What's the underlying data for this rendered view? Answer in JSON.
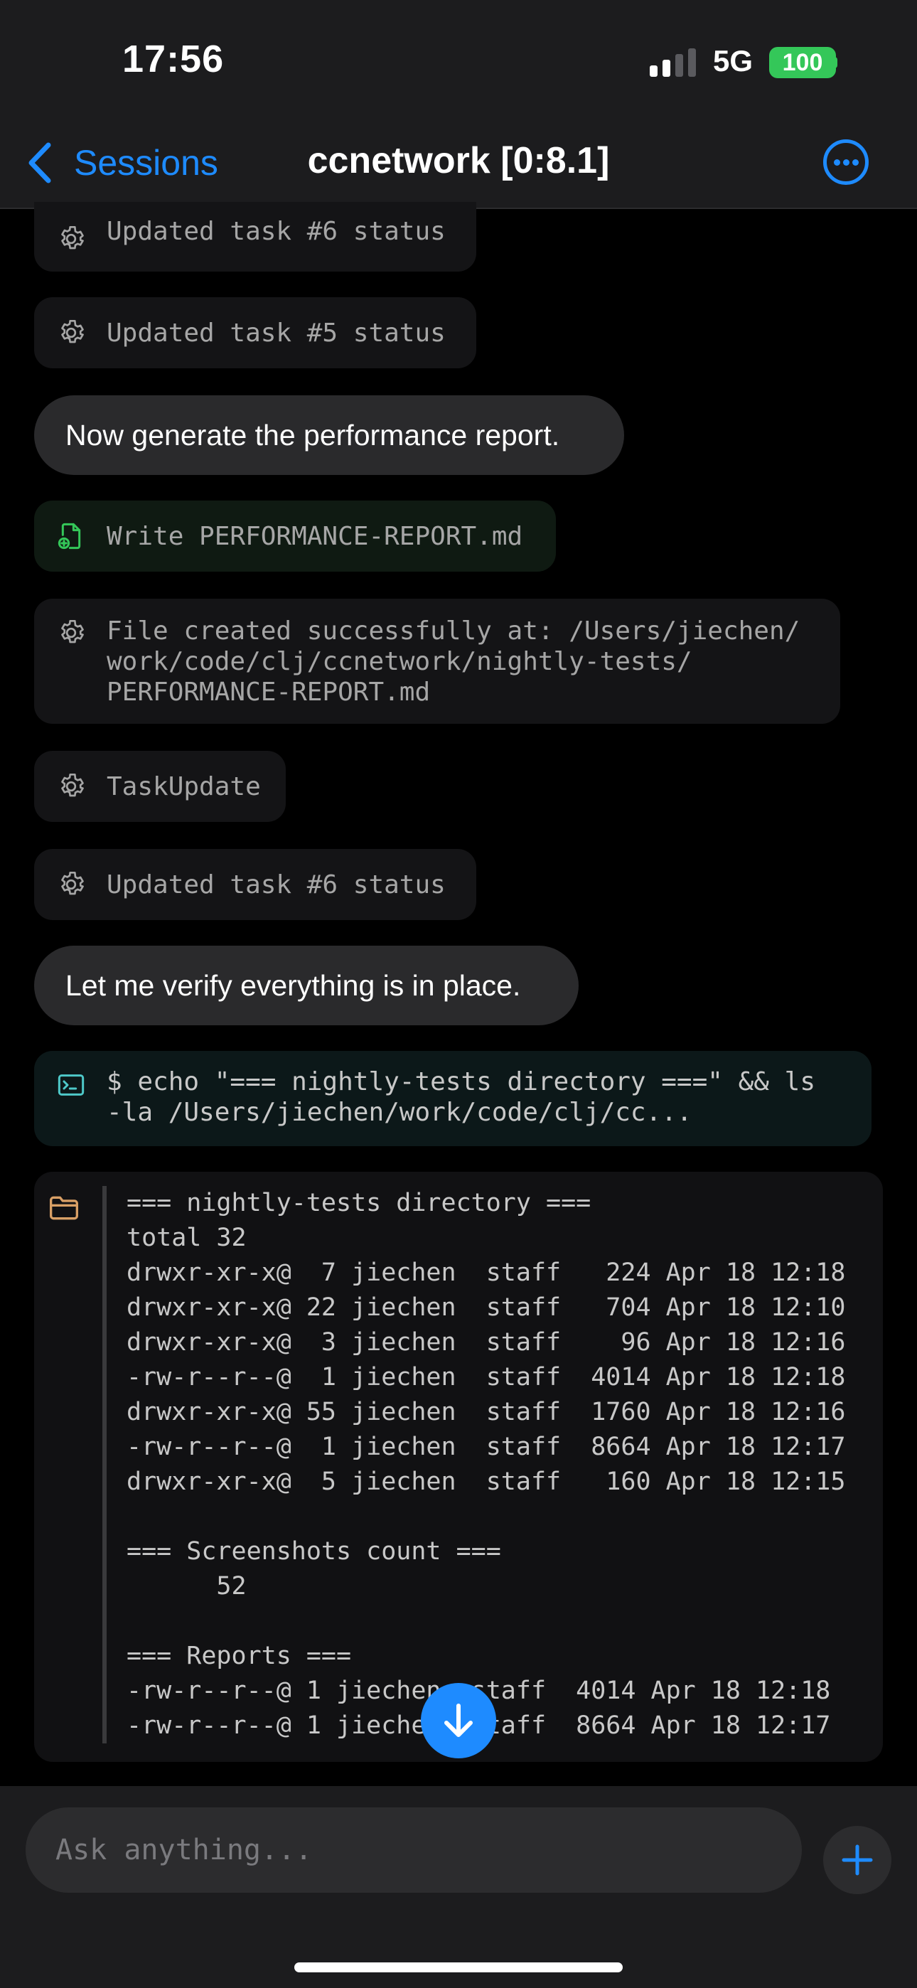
{
  "status_bar": {
    "time": "17:56",
    "network": "5G",
    "battery": "100"
  },
  "nav": {
    "back_label": "Sessions",
    "title": "ccnetwork [0:8.1]"
  },
  "messages": {
    "tool1": "Updated task #6 status",
    "tool2": "Updated task #5 status",
    "user1": "Now generate the performance report.",
    "write": "Write PERFORMANCE-REPORT.md",
    "file_created": [
      "File created successfully at: /Users/jiechen/",
      "work/code/clj/ccnetwork/nightly-tests/",
      "PERFORMANCE-REPORT.md"
    ],
    "task_update": "TaskUpdate",
    "tool3": "Updated task #6 status",
    "user2": "Let me verify everything is in place.",
    "bash": [
      "$ echo \"=== nightly-tests directory ===\" && ls",
      "-la /Users/jiechen/work/code/clj/cc..."
    ]
  },
  "output_lines": [
    "=== nightly-tests directory ===",
    "total 32",
    "drwxr-xr-x@  7 jiechen  staff   224 Apr 18 12:18",
    "drwxr-xr-x@ 22 jiechen  staff   704 Apr 18 12:10",
    "drwxr-xr-x@  3 jiechen  staff    96 Apr 18 12:16",
    "-rw-r--r--@  1 jiechen  staff  4014 Apr 18 12:18",
    "drwxr-xr-x@ 55 jiechen  staff  1760 Apr 18 12:16",
    "-rw-r--r--@  1 jiechen  staff  8664 Apr 18 12:17",
    "drwxr-xr-x@  5 jiechen  staff   160 Apr 18 12:15",
    "",
    "=== Screenshots count ===",
    "      52",
    "",
    "=== Reports ===",
    "-rw-r--r--@ 1 jiechen  staff  4014 Apr 18 12:18",
    "-rw-r--r--@ 1 jiechen  staff  8664 Apr 18 12:17"
  ],
  "composer": {
    "placeholder": "Ask anything..."
  },
  "colors": {
    "accent": "#1e8bff",
    "battery": "#34c759",
    "write_icon": "#34c759",
    "bash_icon": "#4ec9c9",
    "folder_icon": "#d9a066"
  }
}
